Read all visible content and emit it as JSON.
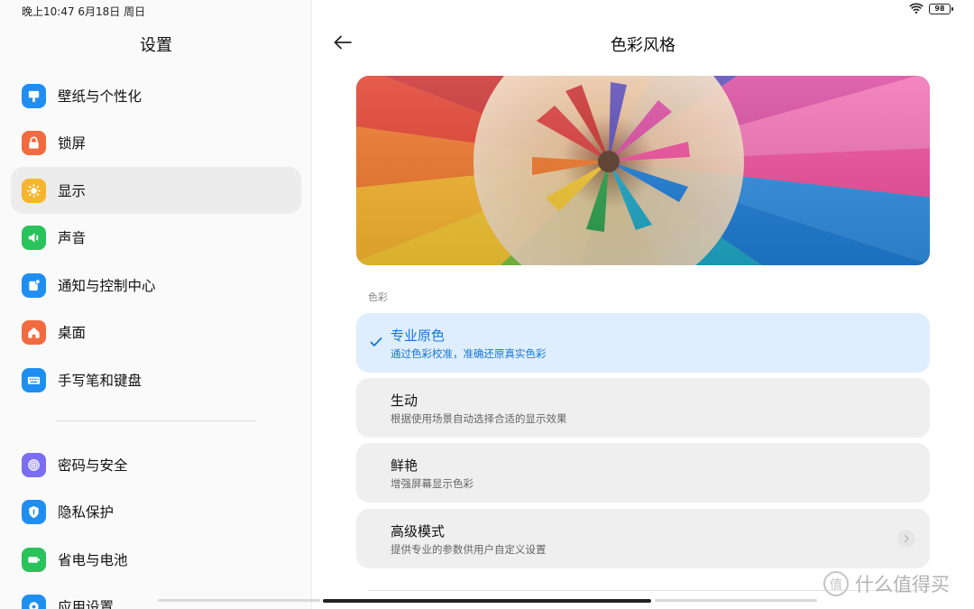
{
  "status_bar": {
    "datetime": "晚上10:47 6月18日 周日",
    "battery": "98"
  },
  "sidebar": {
    "title": "设置",
    "items": [
      {
        "label": "壁纸与个性化",
        "icon": "wallpaper-icon",
        "color": "#1f8ef1"
      },
      {
        "label": "锁屏",
        "icon": "lock-icon",
        "color": "#f26a3f"
      },
      {
        "label": "显示",
        "icon": "brightness-icon",
        "color": "#f5b62d",
        "active": true
      },
      {
        "label": "声音",
        "icon": "speaker-icon",
        "color": "#2ac25a"
      },
      {
        "label": "通知与控制中心",
        "icon": "notification-icon",
        "color": "#1f8ef1"
      },
      {
        "label": "桌面",
        "icon": "home-icon",
        "color": "#f26a3f"
      },
      {
        "label": "手写笔和键盘",
        "icon": "keyboard-icon",
        "color": "#1f8ef1"
      },
      {
        "label": "密码与安全",
        "icon": "fingerprint-icon",
        "color": "#7b6ef0"
      },
      {
        "label": "隐私保护",
        "icon": "privacy-shield-icon",
        "color": "#1f8ef1"
      },
      {
        "label": "省电与电池",
        "icon": "battery-icon",
        "color": "#2ac25a"
      },
      {
        "label": "应用设置",
        "icon": "apps-gear-icon",
        "color": "#1f8ef1"
      }
    ]
  },
  "main": {
    "title": "色彩风格",
    "section_label": "色彩",
    "options": [
      {
        "title": "专业原色",
        "subtitle": "通过色彩校准，准确还原真实色彩",
        "selected": true
      },
      {
        "title": "生动",
        "subtitle": "根据使用场景自动选择合适的显示效果"
      },
      {
        "title": "鲜艳",
        "subtitle": "增强屏幕显示色彩"
      },
      {
        "title": "高级模式",
        "subtitle": "提供专业的参数供用户自定义设置",
        "chevron": true
      }
    ],
    "accent_color": "#1576d8",
    "selected_bg": "#dfeefc"
  },
  "watermark": {
    "text": "什么值得买",
    "logo_char": "值"
  }
}
